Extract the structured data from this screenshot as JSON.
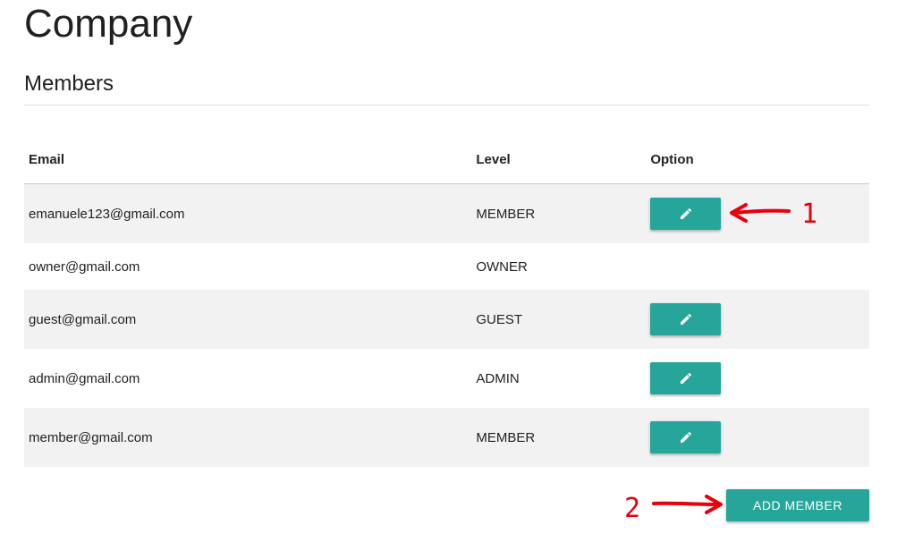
{
  "page": {
    "title": "Company"
  },
  "section": {
    "title": "Members"
  },
  "table": {
    "columns": {
      "email": "Email",
      "level": "Level",
      "option": "Option"
    },
    "rows": [
      {
        "email": "emanuele123@gmail.com",
        "level": "MEMBER",
        "has_edit": true
      },
      {
        "email": "owner@gmail.com",
        "level": "OWNER",
        "has_edit": false
      },
      {
        "email": "guest@gmail.com",
        "level": "GUEST",
        "has_edit": true
      },
      {
        "email": "admin@gmail.com",
        "level": "ADMIN",
        "has_edit": true
      },
      {
        "email": "member@gmail.com",
        "level": "MEMBER",
        "has_edit": true
      }
    ],
    "edit_icon": "pencil-icon"
  },
  "actions": {
    "add_member_label": "ADD MEMBER"
  },
  "annotations": {
    "first_label": "1",
    "second_label": "2",
    "color": "#e8000b"
  },
  "colors": {
    "accent": "#26a69a",
    "row_alt": "#f2f2f2"
  }
}
